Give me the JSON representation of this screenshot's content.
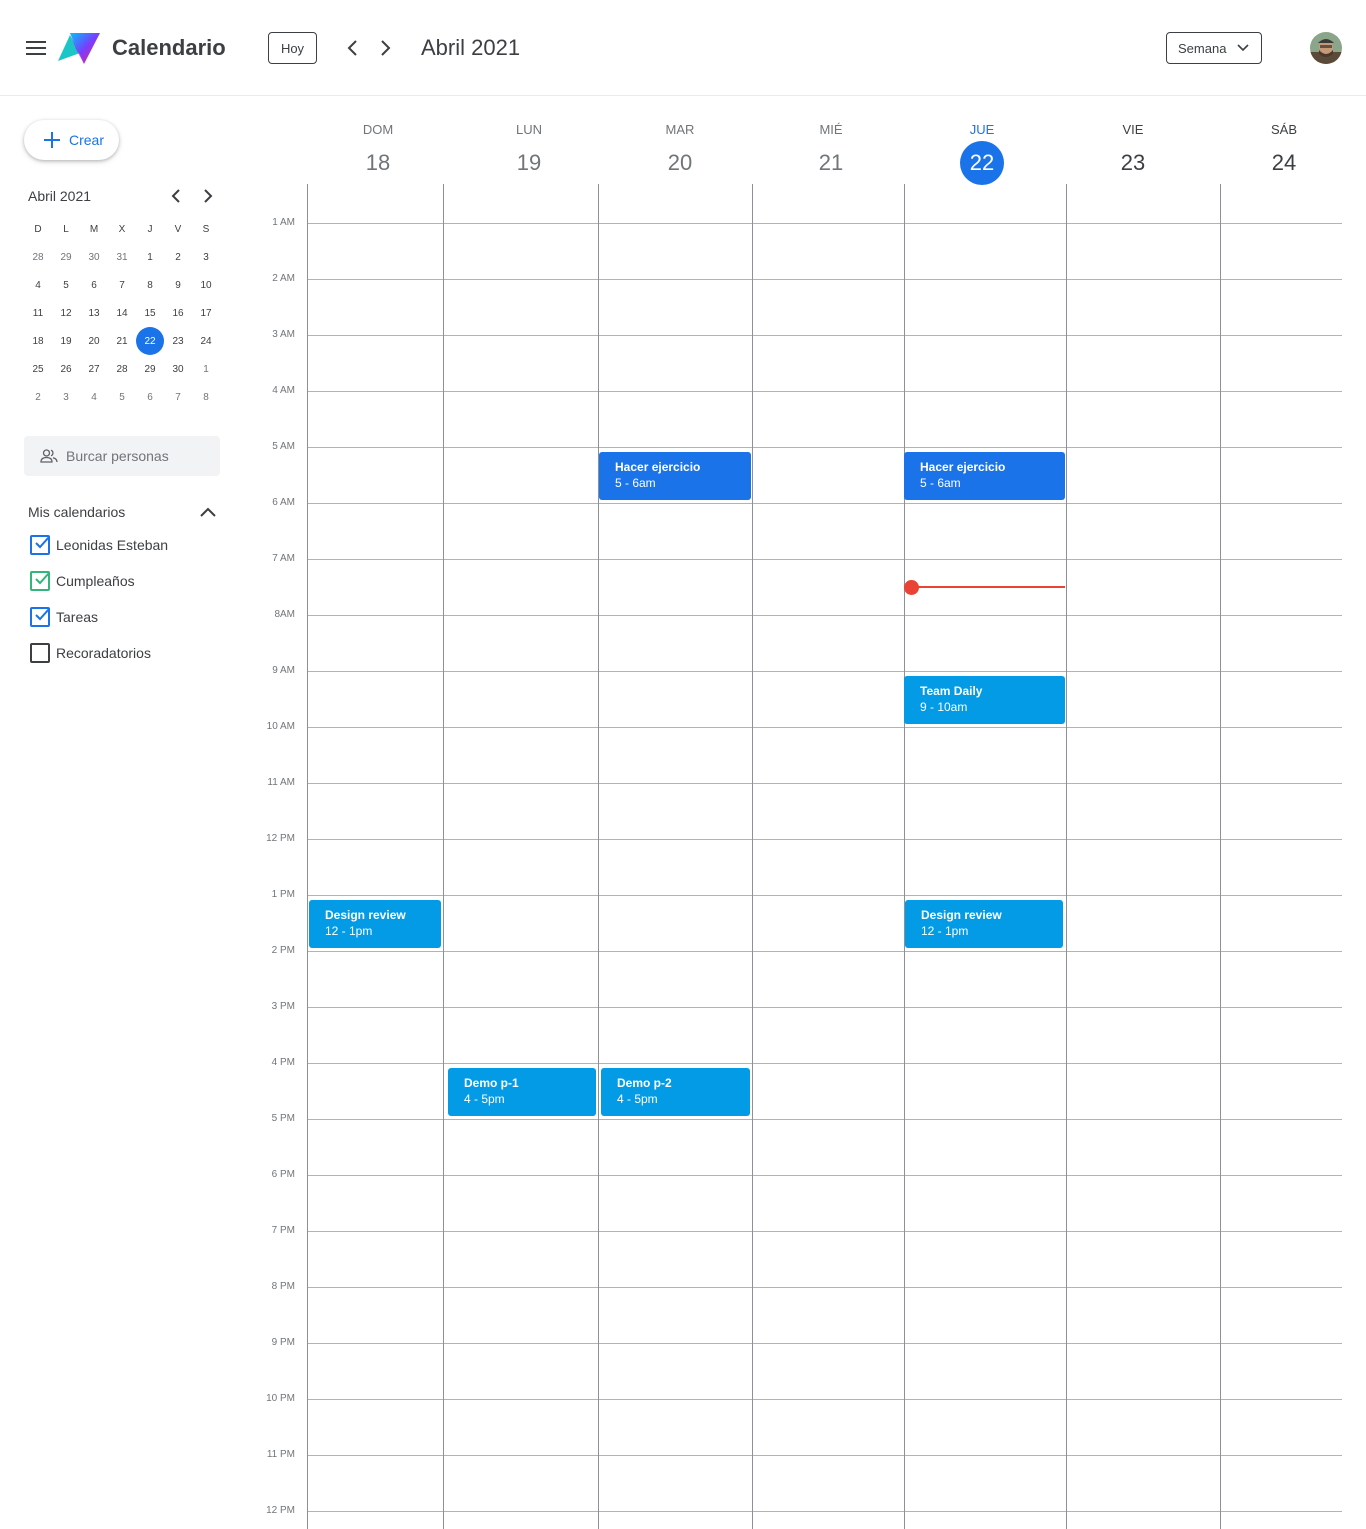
{
  "header": {
    "app_title": "Calendario",
    "today_label": "Hoy",
    "current_period": "Abril 2021",
    "view_label": "Semana"
  },
  "sidebar": {
    "create_label": "Crear",
    "mini_calendar": {
      "title": "Abril 2021",
      "weekdays": [
        "D",
        "L",
        "M",
        "X",
        "J",
        "V",
        "S"
      ],
      "weeks": [
        [
          "28",
          "29",
          "30",
          "31",
          "1",
          "2",
          "3"
        ],
        [
          "4",
          "5",
          "6",
          "7",
          "8",
          "9",
          "10"
        ],
        [
          "11",
          "12",
          "13",
          "14",
          "15",
          "16",
          "17"
        ],
        [
          "18",
          "19",
          "20",
          "21",
          "22",
          "23",
          "24"
        ],
        [
          "25",
          "26",
          "27",
          "28",
          "29",
          "30",
          "1"
        ],
        [
          "2",
          "3",
          "4",
          "5",
          "6",
          "7",
          "8"
        ]
      ],
      "selected": "22"
    },
    "search_placeholder": "Burcar personas",
    "calendars_title": "Mis calendarios",
    "calendars": [
      {
        "label": "Leonidas Esteban",
        "checked": true,
        "color": "#1a73e8"
      },
      {
        "label": "Cumpleaños",
        "checked": true,
        "color": "#33b679"
      },
      {
        "label": "Tareas",
        "checked": true,
        "color": "#1a73e8"
      },
      {
        "label": "Recoradatorios",
        "checked": false,
        "color": "#3c4043"
      }
    ]
  },
  "week": {
    "days": [
      {
        "name": "DOM",
        "num": "18",
        "state": "past"
      },
      {
        "name": "LUN",
        "num": "19",
        "state": "past"
      },
      {
        "name": "MAR",
        "num": "20",
        "state": "past"
      },
      {
        "name": "MIÉ",
        "num": "21",
        "state": "past"
      },
      {
        "name": "JUE",
        "num": "22",
        "state": "today"
      },
      {
        "name": "VIE",
        "num": "23",
        "state": "future"
      },
      {
        "name": "SÁB",
        "num": "24",
        "state": "future"
      }
    ],
    "hours": [
      "1 AM",
      "2 AM",
      "3 AM",
      "4 AM",
      "5 AM",
      "6 AM",
      "7 AM",
      "8AM",
      "9 AM",
      "10 AM",
      "11 AM",
      "12 PM",
      "1 PM",
      "2 PM",
      "3 PM",
      "4 PM",
      "5 PM",
      "6 PM",
      "7 PM",
      "8 PM",
      "9 PM",
      "10 PM",
      "11 PM",
      "12 PM"
    ]
  },
  "events": [
    {
      "title": "Hacer ejercicio",
      "time": "5 - 6am",
      "style": "dark"
    },
    {
      "title": "Hacer ejercicio",
      "time": "5 - 6am",
      "style": "dark"
    },
    {
      "title": "Team Daily",
      "time": "9 - 10am",
      "style": "light"
    },
    {
      "title": "Design review",
      "time": "12 - 1pm",
      "style": "light"
    },
    {
      "title": "Design review",
      "time": "12 - 1pm",
      "style": "light"
    },
    {
      "title": "Demo p-1",
      "time": "4 - 5pm",
      "style": "light"
    },
    {
      "title": "Demo p-2",
      "time": "4 - 5pm",
      "style": "light"
    }
  ],
  "colors": {
    "accent": "#1a73e8",
    "event_light": "#039be5",
    "now_indicator": "#ea4335"
  }
}
